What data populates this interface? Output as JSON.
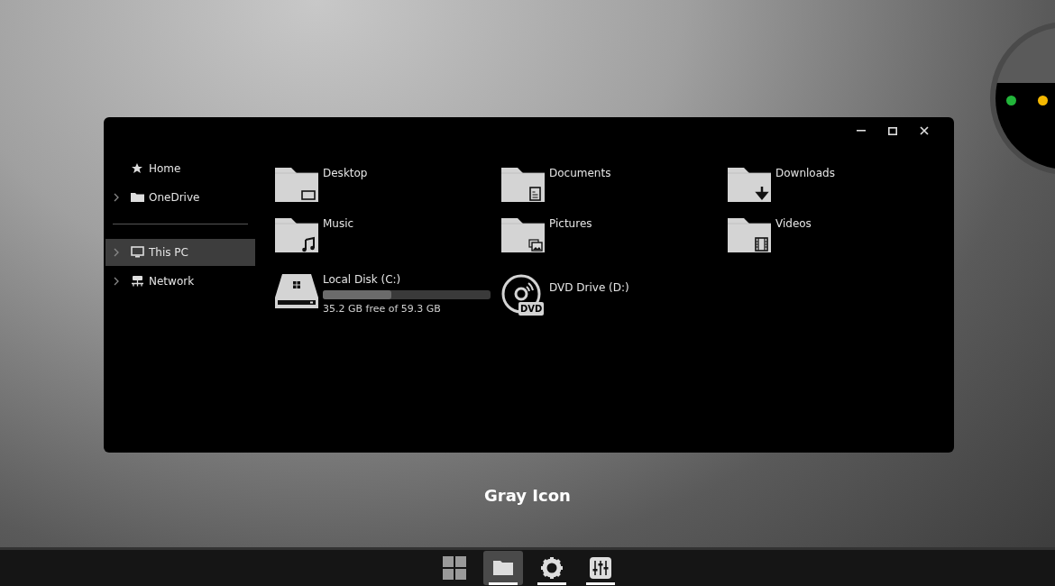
{
  "window": {
    "controls": [
      {
        "kind": "minimize"
      },
      {
        "kind": "maximize"
      },
      {
        "kind": "close"
      }
    ]
  },
  "sidebar": {
    "groups": [
      [
        {
          "label": "Home",
          "kind": "star",
          "expandable": false,
          "selected": false
        },
        {
          "label": "OneDrive",
          "kind": "folder",
          "expandable": true,
          "selected": false
        }
      ],
      [
        {
          "label": "This PC",
          "kind": "monitor",
          "expandable": true,
          "selected": true
        },
        {
          "label": "Network",
          "kind": "network",
          "expandable": true,
          "selected": false
        }
      ]
    ]
  },
  "folders": [
    {
      "label": "Desktop",
      "kind": "desktop"
    },
    {
      "label": "Documents",
      "kind": "documents"
    },
    {
      "label": "Downloads",
      "kind": "downloads"
    },
    {
      "label": "Music",
      "kind": "music"
    },
    {
      "label": "Pictures",
      "kind": "pictures"
    },
    {
      "label": "Videos",
      "kind": "videos"
    }
  ],
  "drives": [
    {
      "label": "Local Disk (C:)",
      "kind": "disk",
      "level": 0.406,
      "free": "35.2 GB free of 59.3 GB"
    },
    {
      "label": "DVD Drive (D:)",
      "kind": "dvd",
      "badge": "DVD"
    }
  ],
  "caption": "Gray Icon",
  "lens": {
    "dots": [
      {
        "color": "#22b53a"
      },
      {
        "color": "#f5b800"
      }
    ]
  },
  "taskbar": [
    {
      "kind": "start",
      "selected": false,
      "running": false
    },
    {
      "kind": "explorer",
      "selected": true,
      "running": true
    },
    {
      "kind": "settings",
      "selected": false,
      "running": true
    },
    {
      "kind": "mixer",
      "selected": false,
      "running": true
    }
  ]
}
